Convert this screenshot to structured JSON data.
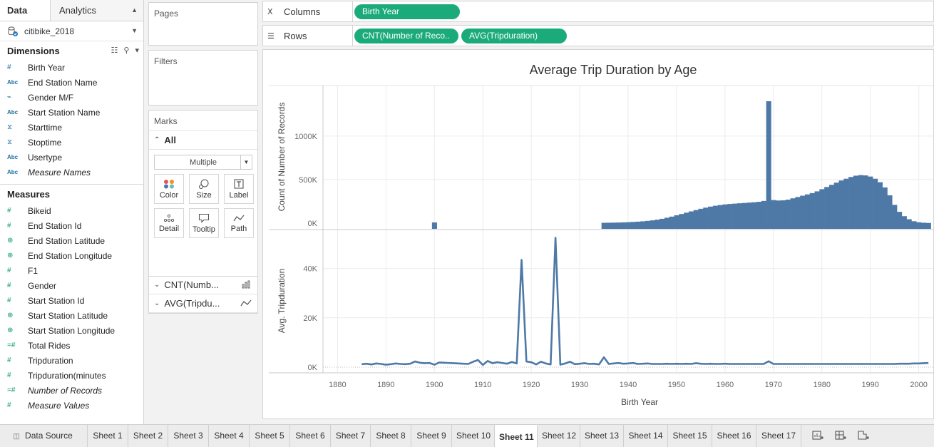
{
  "data_pane": {
    "tab_data": "Data",
    "tab_analytics": "Analytics",
    "datasource": "citibike_2018",
    "dimensions_title": "Dimensions",
    "dimensions": [
      {
        "icon": "#",
        "name": "Birth Year",
        "italic": false,
        "kind": "number"
      },
      {
        "icon": "Abc",
        "name": "End Station Name",
        "italic": false,
        "kind": "string"
      },
      {
        "icon": "link-icon",
        "name": "Gender M/F",
        "italic": false,
        "kind": "group"
      },
      {
        "icon": "Abc",
        "name": "Start Station Name",
        "italic": false,
        "kind": "string"
      },
      {
        "icon": "date-icon",
        "name": "Starttime",
        "italic": false,
        "kind": "date"
      },
      {
        "icon": "date-icon",
        "name": "Stoptime",
        "italic": false,
        "kind": "date"
      },
      {
        "icon": "Abc",
        "name": "Usertype",
        "italic": false,
        "kind": "string"
      },
      {
        "icon": "Abc",
        "name": "Measure Names",
        "italic": true,
        "kind": "string"
      }
    ],
    "measures_title": "Measures",
    "measures": [
      {
        "icon": "#",
        "name": "Bikeid",
        "italic": false,
        "kind": "number"
      },
      {
        "icon": "#",
        "name": "End Station Id",
        "italic": false,
        "kind": "number"
      },
      {
        "icon": "globe-icon",
        "name": "End Station Latitude",
        "italic": false,
        "kind": "geo"
      },
      {
        "icon": "globe-icon",
        "name": "End Station Longitude",
        "italic": false,
        "kind": "geo"
      },
      {
        "icon": "#",
        "name": "F1",
        "italic": false,
        "kind": "number"
      },
      {
        "icon": "#",
        "name": "Gender",
        "italic": false,
        "kind": "number"
      },
      {
        "icon": "#",
        "name": "Start Station Id",
        "italic": false,
        "kind": "number"
      },
      {
        "icon": "globe-icon",
        "name": "Start Station Latitude",
        "italic": false,
        "kind": "geo"
      },
      {
        "icon": "globe-icon",
        "name": "Start Station Longitude",
        "italic": false,
        "kind": "geo"
      },
      {
        "icon": "=#",
        "name": "Total Rides",
        "italic": false,
        "kind": "calc"
      },
      {
        "icon": "#",
        "name": "Tripduration",
        "italic": false,
        "kind": "number"
      },
      {
        "icon": "#",
        "name": "Tripduration(minutes",
        "italic": false,
        "kind": "number"
      },
      {
        "icon": "=#",
        "name": "Number of Records",
        "italic": true,
        "kind": "calc"
      },
      {
        "icon": "#",
        "name": "Measure Values",
        "italic": true,
        "kind": "number"
      }
    ]
  },
  "cards": {
    "pages": "Pages",
    "filters": "Filters",
    "marks": "Marks",
    "marks_all": "All",
    "mark_type": "Multiple",
    "mark_buttons": [
      "Color",
      "Size",
      "Label",
      "Detail",
      "Tooltip",
      "Path"
    ],
    "marks_sub_cnt": "CNT(Numb...",
    "marks_sub_avg": "AVG(Tripdu..."
  },
  "shelves": {
    "columns_label": "Columns",
    "rows_label": "Rows",
    "columns_pills": [
      "Birth Year"
    ],
    "rows_pills": [
      "CNT(Number of Reco..",
      "AVG(Tripduration)"
    ]
  },
  "colors": {
    "bar": "#4e79a7",
    "line": "#4e79a7",
    "pill": "#1bab7a"
  },
  "chart_data": [
    {
      "type": "bar",
      "title": "Average Trip Duration by Age",
      "xlabel": "Birth Year",
      "ylabel": "Count of Number of Records",
      "yticks": [
        "0K",
        "500K",
        "1000K"
      ],
      "ylim": [
        0,
        1580000
      ],
      "x": [
        1900,
        1935,
        1936,
        1937,
        1938,
        1939,
        1940,
        1941,
        1942,
        1943,
        1944,
        1945,
        1946,
        1947,
        1948,
        1949,
        1950,
        1951,
        1952,
        1953,
        1954,
        1955,
        1956,
        1957,
        1958,
        1959,
        1960,
        1961,
        1962,
        1963,
        1964,
        1965,
        1966,
        1967,
        1968,
        1969,
        1970,
        1971,
        1972,
        1973,
        1974,
        1975,
        1976,
        1977,
        1978,
        1979,
        1980,
        1981,
        1982,
        1983,
        1984,
        1985,
        1986,
        1987,
        1988,
        1989,
        1990,
        1991,
        1992,
        1993,
        1994,
        1995,
        1996,
        1997,
        1998,
        1999,
        2000,
        2001,
        2002
      ],
      "values": [
        8000,
        4000,
        5000,
        6000,
        7000,
        9000,
        11000,
        14000,
        17000,
        21000,
        26000,
        32000,
        40000,
        50000,
        62000,
        75000,
        90000,
        105000,
        120000,
        135000,
        150000,
        165000,
        178000,
        190000,
        200000,
        208000,
        215000,
        220000,
        224000,
        228000,
        232000,
        236000,
        240000,
        245000,
        255000,
        1400000,
        265000,
        260000,
        262000,
        270000,
        285000,
        300000,
        315000,
        330000,
        345000,
        365000,
        390000,
        415000,
        440000,
        465000,
        490000,
        510000,
        530000,
        545000,
        552000,
        548000,
        535000,
        510000,
        470000,
        410000,
        320000,
        210000,
        130000,
        80000,
        45000,
        22000,
        10000,
        5000,
        2000
      ]
    },
    {
      "type": "line",
      "xlabel": "Birth Year",
      "ylabel": "Avg. Tripduration",
      "yticks": [
        "0K",
        "20K",
        "40K"
      ],
      "xticks": [
        "1880",
        "1890",
        "1900",
        "1910",
        "1920",
        "1930",
        "1940",
        "1950",
        "1960",
        "1970",
        "1980",
        "1990",
        "2000"
      ],
      "xlim": [
        1877,
        2003
      ],
      "ylim": [
        0,
        55500
      ],
      "x": [
        1885,
        1886,
        1887,
        1888,
        1889,
        1890,
        1891,
        1892,
        1893,
        1894,
        1895,
        1896,
        1897,
        1898,
        1899,
        1900,
        1901,
        1902,
        1903,
        1904,
        1905,
        1906,
        1907,
        1908,
        1909,
        1910,
        1911,
        1912,
        1913,
        1914,
        1915,
        1916,
        1917,
        1918,
        1919,
        1920,
        1921,
        1922,
        1923,
        1924,
        1925,
        1926,
        1927,
        1928,
        1929,
        1930,
        1931,
        1932,
        1933,
        1934,
        1935,
        1936,
        1937,
        1938,
        1939,
        1940,
        1941,
        1942,
        1943,
        1944,
        1945,
        1946,
        1947,
        1948,
        1949,
        1950,
        1951,
        1952,
        1953,
        1954,
        1955,
        1956,
        1957,
        1958,
        1959,
        1960,
        1961,
        1962,
        1963,
        1964,
        1965,
        1966,
        1967,
        1968,
        1969,
        1970,
        1971,
        1972,
        1973,
        1974,
        1975,
        1976,
        1977,
        1978,
        1979,
        1980,
        1981,
        1982,
        1983,
        1984,
        1985,
        1986,
        1987,
        1988,
        1989,
        1990,
        1991,
        1992,
        1993,
        1994,
        1995,
        1996,
        1997,
        1998,
        1999,
        2000,
        2001,
        2002
      ],
      "values": [
        1200,
        1400,
        1100,
        1500,
        1300,
        1000,
        1200,
        1500,
        1300,
        1200,
        1400,
        2300,
        1800,
        1600,
        1700,
        1000,
        1900,
        1800,
        1700,
        1600,
        1500,
        1400,
        1300,
        2200,
        2900,
        900,
        2500,
        1600,
        2000,
        1700,
        1400,
        2100,
        1500,
        43500,
        2300,
        2000,
        1100,
        2200,
        1500,
        1100,
        52500,
        1000,
        1500,
        2200,
        1200,
        1400,
        1600,
        1300,
        1400,
        1100,
        4000,
        1300,
        1500,
        1700,
        1400,
        1500,
        1700,
        1300,
        1400,
        1500,
        1300,
        1300,
        1300,
        1400,
        1300,
        1400,
        1300,
        1400,
        1300,
        1600,
        1400,
        1300,
        1400,
        1300,
        1300,
        1400,
        1300,
        1300,
        1300,
        1300,
        1300,
        1300,
        1300,
        1300,
        2400,
        1300,
        1300,
        1300,
        1300,
        1300,
        1300,
        1300,
        1300,
        1300,
        1300,
        1300,
        1300,
        1300,
        1300,
        1300,
        1300,
        1300,
        1300,
        1300,
        1300,
        1300,
        1300,
        1300,
        1300,
        1300,
        1300,
        1400,
        1400,
        1400,
        1500,
        1500,
        1600,
        1700,
        3000
      ]
    }
  ],
  "tabbar": {
    "datasource": "Data Source",
    "sheets": [
      "Sheet 1",
      "Sheet 2",
      "Sheet 3",
      "Sheet 4",
      "Sheet 5",
      "Sheet 6",
      "Sheet 7",
      "Sheet 8",
      "Sheet 9",
      "Sheet 10",
      "Sheet 11",
      "Sheet 12",
      "Sheet 13",
      "Sheet 14",
      "Sheet 15",
      "Sheet 16",
      "Sheet 17"
    ],
    "active": "Sheet 11",
    "actions": [
      "new-worksheet-icon",
      "new-dashboard-icon",
      "new-story-icon"
    ]
  }
}
